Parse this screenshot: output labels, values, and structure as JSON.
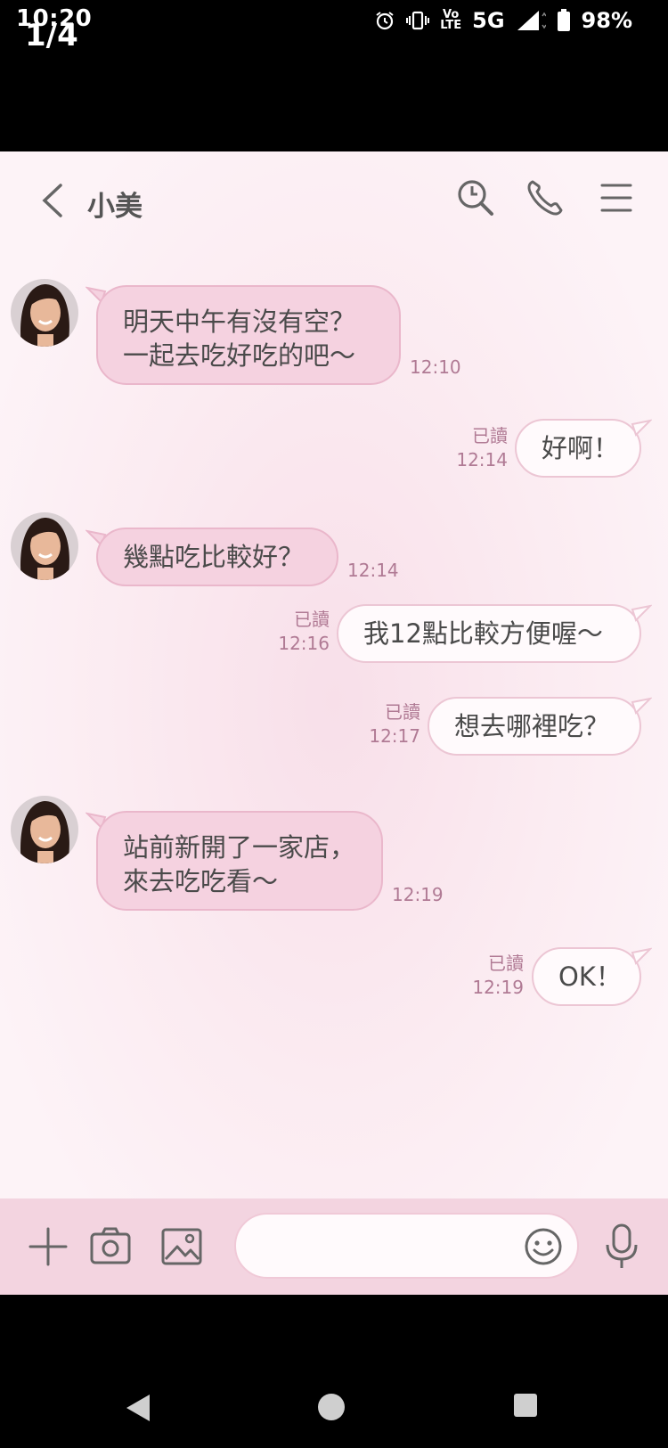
{
  "status_bar": {
    "time": "10:20",
    "page_indicator": "1/4",
    "network": "5G",
    "battery": "98%",
    "volte_line1": "Vo",
    "volte_line2": "LTE"
  },
  "header": {
    "contact_name": "小美"
  },
  "messages": [
    {
      "direction": "incoming",
      "lines": [
        "明天中午有沒有空？",
        "一起去吃好吃的吧～"
      ],
      "time": "12:10"
    },
    {
      "direction": "outgoing",
      "text": "好啊！",
      "read_label": "已讀",
      "time": "12:14"
    },
    {
      "direction": "incoming",
      "text": "幾點吃比較好？",
      "time": "12:14"
    },
    {
      "direction": "outgoing",
      "text": "我12點比較方便喔～",
      "read_label": "已讀",
      "time": "12:16"
    },
    {
      "direction": "outgoing",
      "text": "想去哪裡吃？",
      "read_label": "已讀",
      "time": "12:17"
    },
    {
      "direction": "incoming",
      "lines": [
        "站前新開了一家店，",
        "來去吃吃看～"
      ],
      "time": "12:19"
    },
    {
      "direction": "outgoing",
      "text": "OK！",
      "read_label": "已讀",
      "time": "12:19"
    }
  ],
  "input_bar": {
    "placeholder": "",
    "value": ""
  },
  "colors": {
    "incoming_bubble": "#f5d2e0",
    "outgoing_bubble": "#fffafc",
    "accent_text": "#b07a94",
    "input_bar": "#f3d4e0"
  },
  "icons": [
    "back-icon",
    "search-icon",
    "phone-icon",
    "menu-icon",
    "plus-icon",
    "camera-icon",
    "image-icon",
    "emoji-icon",
    "mic-icon"
  ]
}
